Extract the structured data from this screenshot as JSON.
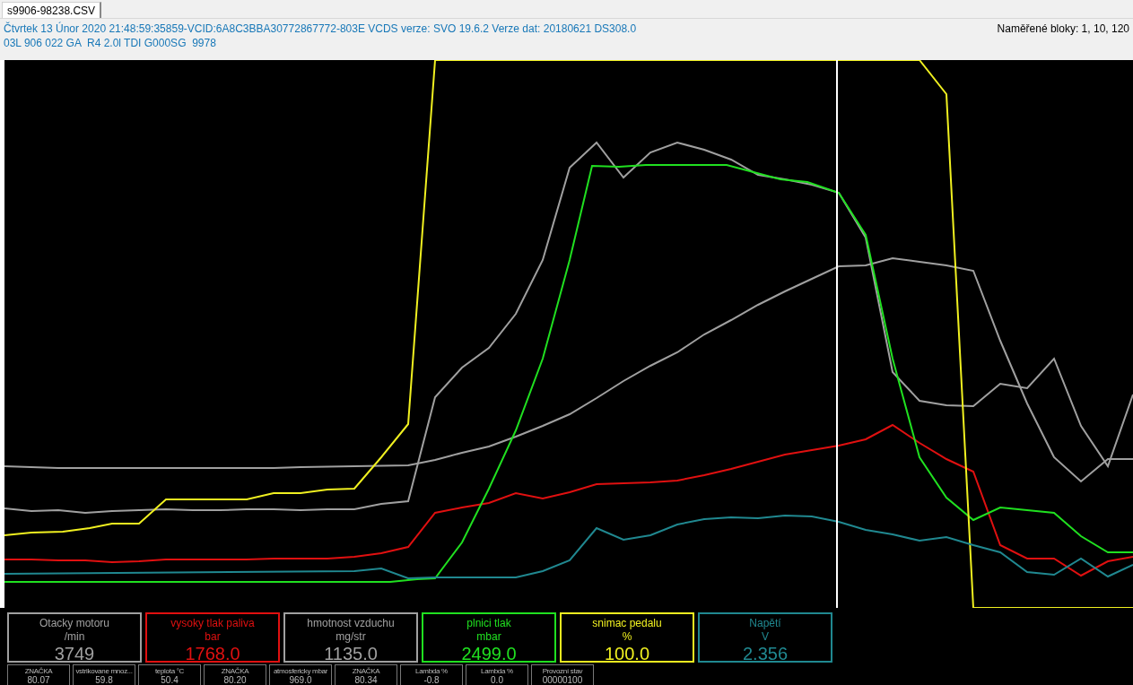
{
  "tabs": [
    {
      "label": "s9906-98238.CSV",
      "selected": true
    }
  ],
  "header": {
    "info_lines": [
      "Čtvrtek 13 Únor 2020 21:48:59:35859-VCID:6A8C3BBA30772867772-803E VCDS verze: SVO 19.6.2 Verze dat: 20180621 DS308.0",
      "03L 906 022 GA  R4 2.0l TDI G000SG  9978"
    ],
    "blocks": "Naměřené bloky: 1, 10, 120"
  },
  "gauges": [
    {
      "label": "Otacky motoru",
      "unit": "/min",
      "value": "3749",
      "color": "#a0a0a0"
    },
    {
      "label": "vysoky tlak paliva",
      "unit": "bar",
      "value": "1768.0",
      "color": "#e01010"
    },
    {
      "label": "hmotnost vzduchu",
      "unit": "mg/str",
      "value": "1135.0",
      "color": "#a0a0a0"
    },
    {
      "label": "plnici tlak",
      "unit": "mbar",
      "value": "2499.0",
      "color": "#20e020"
    },
    {
      "label": "snimac pedalu",
      "unit": "%",
      "value": "100.0",
      "color": "#f0f020"
    },
    {
      "label": "Napětí",
      "unit": "V",
      "value": "2.356",
      "color": "#208890"
    }
  ],
  "small_readouts": [
    {
      "label": "ZNAČKA",
      "value": "80.07"
    },
    {
      "label": "vstrikovane mnoz...",
      "value": "59.8"
    },
    {
      "label": "teplota °C",
      "value": "50.4"
    },
    {
      "label": "ZNAČKA",
      "value": "80.20"
    },
    {
      "label": "atmosfericky mbar",
      "value": "969.0"
    },
    {
      "label": "ZNAČKA",
      "value": "80.34"
    },
    {
      "label": "Lambda %",
      "value": "-0.8"
    },
    {
      "label": "Lambda %",
      "value": "0.0"
    },
    {
      "label": "Provozní stav",
      "value": "00000100"
    }
  ]
}
